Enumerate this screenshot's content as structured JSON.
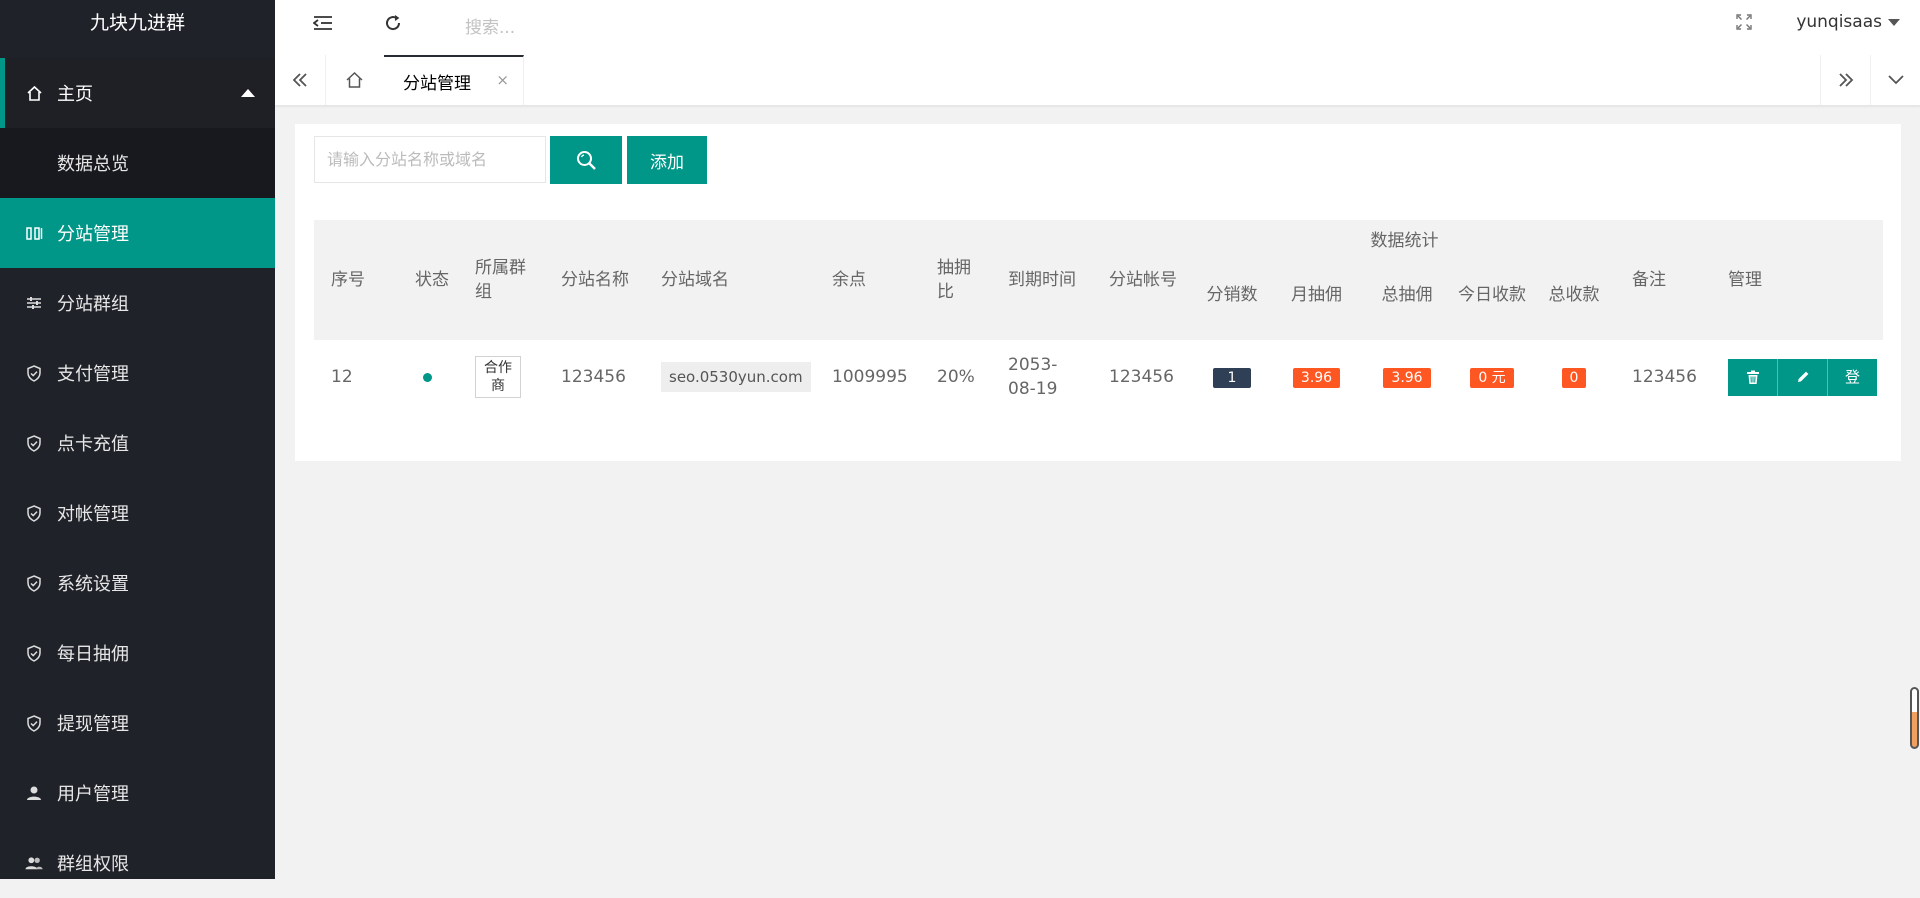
{
  "app": {
    "logo": "九块九进群"
  },
  "sidebar": {
    "items": [
      {
        "label": "主页",
        "icon": "home-icon"
      },
      {
        "label": "数据总览"
      },
      {
        "label": "分站管理",
        "icon": "columns-icon"
      },
      {
        "label": "分站群组",
        "icon": "sliders-icon"
      },
      {
        "label": "支付管理",
        "icon": "shield-check-icon"
      },
      {
        "label": "点卡充值",
        "icon": "shield-check-icon"
      },
      {
        "label": "对帐管理",
        "icon": "shield-check-icon"
      },
      {
        "label": "系统设置",
        "icon": "shield-check-icon"
      },
      {
        "label": "每日抽佣",
        "icon": "shield-check-icon"
      },
      {
        "label": "提现管理",
        "icon": "shield-check-icon"
      },
      {
        "label": "用户管理",
        "icon": "user-icon"
      },
      {
        "label": "群组权限",
        "icon": "users-icon"
      }
    ]
  },
  "header": {
    "search_placeholder": "搜索...",
    "username": "yunqisaas"
  },
  "tabs": {
    "active_label": "分站管理",
    "close_glyph": "×"
  },
  "toolbar": {
    "filter_placeholder": "请输入分站名称或域名",
    "add_label": "添加"
  },
  "table": {
    "headers": {
      "index": "序号",
      "status": "状态",
      "group": "所属群组",
      "name": "分站名称",
      "domain": "分站域名",
      "balance": "余点",
      "ratio": "抽拥比",
      "expire": "到期时间",
      "account": "分站帐号",
      "stats": "数据统计",
      "distributors": "分销数",
      "month_commission": "月抽佣",
      "total_commission": "总抽佣",
      "today_income": "今日收款",
      "total_income": "总收款",
      "remark": "备注",
      "manage": "管理"
    },
    "rows": [
      {
        "index": "12",
        "group": "合作商",
        "name": "123456",
        "domain": "seo.0530yun.com",
        "balance": "1009995",
        "ratio": "20%",
        "expire": "2053-08-19",
        "account": "123456",
        "distributors": "1",
        "month_commission": "3.96",
        "total_commission": "3.96",
        "today_income": "0 元",
        "total_income": "0",
        "remark": "123456",
        "ops": {
          "delete_icon": "trash-icon",
          "edit_icon": "pencil-icon",
          "login_label": "登"
        }
      }
    ]
  },
  "colors": {
    "primary": "#009688",
    "sidebar_bg": "#20222a",
    "badge_orange": "#ff5722",
    "badge_dark": "#2f4056"
  }
}
